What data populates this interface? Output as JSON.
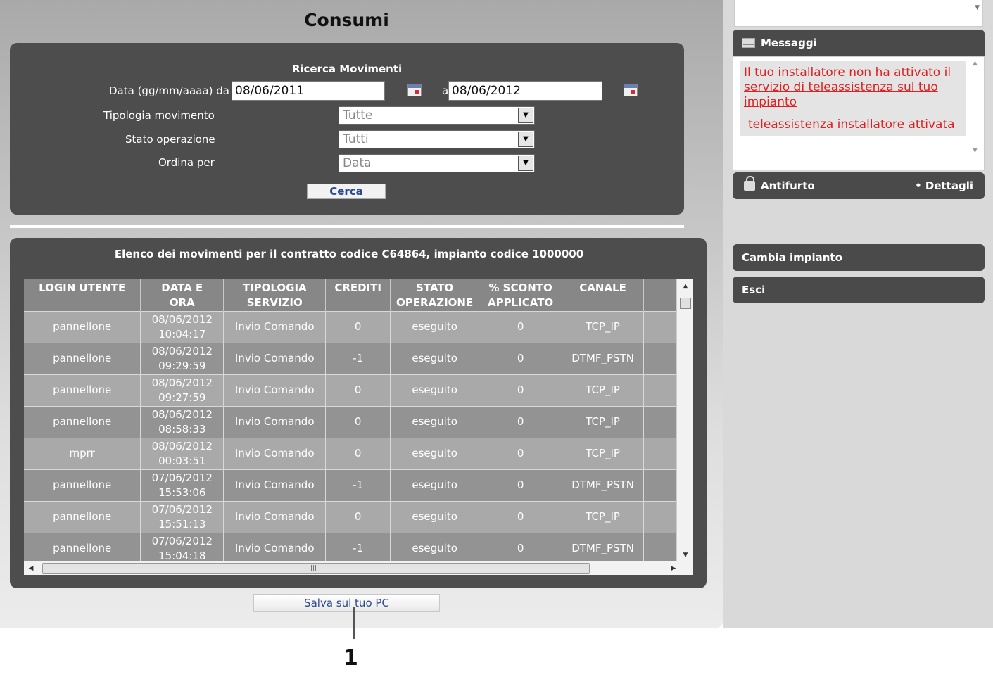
{
  "page": {
    "title": "Consumi"
  },
  "search": {
    "title": "Ricerca Movimenti",
    "date_label": "Data (gg/mm/aaaa) da",
    "date_from": "08/06/2011",
    "to_label": "a",
    "date_to": "08/06/2012",
    "tipologia_label": "Tipologia movimento",
    "tipologia_value": "Tutte",
    "stato_label": "Stato operazione",
    "stato_value": "Tutti",
    "ordina_label": "Ordina per",
    "ordina_value": "Data",
    "cerca_label": "Cerca"
  },
  "list": {
    "caption": "Elenco dei movimenti per il contratto codice C64864, impianto codice 1000000",
    "headers": [
      [
        "LOGIN UTENTE",
        ""
      ],
      [
        "DATA E",
        "ORA"
      ],
      [
        "TIPOLOGIA",
        "SERVIZIO"
      ],
      [
        "CREDITI",
        ""
      ],
      [
        "STATO",
        "OPERAZIONE"
      ],
      [
        "% SCONTO",
        "APPLICATO"
      ],
      [
        "CANALE",
        ""
      ]
    ],
    "rows": [
      {
        "login": "pannellone",
        "date": "08/06/2012",
        "time": "10:04:17",
        "tipo": "Invio Comando",
        "crediti": "0",
        "stato": "eseguito",
        "sconto": "0",
        "canale": "TCP_IP"
      },
      {
        "login": "pannellone",
        "date": "08/06/2012",
        "time": "09:29:59",
        "tipo": "Invio Comando",
        "crediti": "-1",
        "stato": "eseguito",
        "sconto": "0",
        "canale": "DTMF_PSTN"
      },
      {
        "login": "pannellone",
        "date": "08/06/2012",
        "time": "09:27:59",
        "tipo": "Invio Comando",
        "crediti": "0",
        "stato": "eseguito",
        "sconto": "0",
        "canale": "TCP_IP"
      },
      {
        "login": "pannellone",
        "date": "08/06/2012",
        "time": "08:58:33",
        "tipo": "Invio Comando",
        "crediti": "0",
        "stato": "eseguito",
        "sconto": "0",
        "canale": "TCP_IP"
      },
      {
        "login": "mprr",
        "date": "08/06/2012",
        "time": "00:03:51",
        "tipo": "Invio Comando",
        "crediti": "0",
        "stato": "eseguito",
        "sconto": "0",
        "canale": "TCP_IP"
      },
      {
        "login": "pannellone",
        "date": "07/06/2012",
        "time": "15:53:06",
        "tipo": "Invio Comando",
        "crediti": "-1",
        "stato": "eseguito",
        "sconto": "0",
        "canale": "DTMF_PSTN"
      },
      {
        "login": "pannellone",
        "date": "07/06/2012",
        "time": "15:51:13",
        "tipo": "Invio Comando",
        "crediti": "0",
        "stato": "eseguito",
        "sconto": "0",
        "canale": "TCP_IP"
      },
      {
        "login": "pannellone",
        "date": "07/06/2012",
        "time": "15:04:18",
        "tipo": "Invio Comando",
        "crediti": "-1",
        "stato": "eseguito",
        "sconto": "0",
        "canale": "DTMF_PSTN"
      }
    ]
  },
  "actions": {
    "salva_label": "Salva sul tuo PC",
    "callout_number": "1"
  },
  "sidebar": {
    "messaggi_title": "Messaggi",
    "message_1": "Il tuo installatore non ha attivato il servizio di teleassistenza sul tuo impianto",
    "message_2": "teleassistenza installatore attivata",
    "antifurto_title": "Antifurto",
    "dettagli_label": "• Dettagli",
    "cambia_label": "Cambia impianto",
    "esci_label": "Esci"
  },
  "colors": {
    "panel": "#4d4d4d",
    "link_red": "#e02020",
    "button_text": "#2c4a8f"
  },
  "icons": [
    "calendar-icon",
    "dropdown-arrow-icon",
    "mail-icon",
    "lock-icon"
  ]
}
